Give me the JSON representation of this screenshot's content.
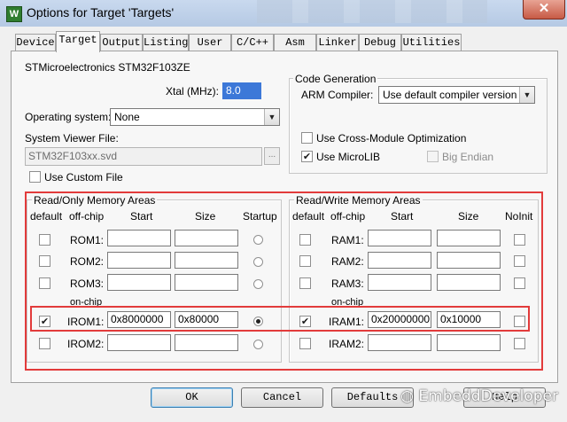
{
  "window": {
    "icon_glyph": "W",
    "title": "Options for Target 'Targets'",
    "close_glyph": "✕"
  },
  "tabs": [
    "Device",
    "Target",
    "Output",
    "Listing",
    "User",
    "C/C++",
    "Asm",
    "Linker",
    "Debug",
    "Utilities"
  ],
  "active_tab": "Target",
  "device_name": "STMicroelectronics STM32F103ZE",
  "xtal": {
    "label": "Xtal (MHz):",
    "value": "8.0"
  },
  "os": {
    "label": "Operating system:",
    "value": "None"
  },
  "svd": {
    "label": "System Viewer File:",
    "value": "STM32F103xx.svd",
    "browse": "...",
    "custom_label": "Use Custom File"
  },
  "codegen": {
    "title": "Code Generation",
    "compiler_label": "ARM Compiler:",
    "compiler_value": "Use default compiler version",
    "cross_module": "Use Cross-Module Optimization",
    "microlib": "Use MicroLIB",
    "big_endian": "Big Endian",
    "check_mark": "✔"
  },
  "rom": {
    "title": "Read/Only Memory Areas",
    "headers": {
      "default": "default",
      "offchip": "off-chip",
      "start": "Start",
      "size": "Size",
      "startup": "Startup"
    },
    "onchip": "on-chip",
    "rows": [
      {
        "label": "ROM1:",
        "start": "",
        "size": "",
        "default": false,
        "startup": false
      },
      {
        "label": "ROM2:",
        "start": "",
        "size": "",
        "default": false,
        "startup": false
      },
      {
        "label": "ROM3:",
        "start": "",
        "size": "",
        "default": false,
        "startup": false
      },
      {
        "label": "IROM1:",
        "start": "0x8000000",
        "size": "0x80000",
        "default": true,
        "startup": true
      },
      {
        "label": "IROM2:",
        "start": "",
        "size": "",
        "default": false,
        "startup": false
      }
    ]
  },
  "ram": {
    "title": "Read/Write Memory Areas",
    "headers": {
      "default": "default",
      "offchip": "off-chip",
      "start": "Start",
      "size": "Size",
      "noinit": "NoInit"
    },
    "onchip": "on-chip",
    "rows": [
      {
        "label": "RAM1:",
        "start": "",
        "size": ""
      },
      {
        "label": "RAM2:",
        "start": "",
        "size": ""
      },
      {
        "label": "RAM3:",
        "start": "",
        "size": ""
      },
      {
        "label": "IRAM1:",
        "start": "0x20000000",
        "size": "0x10000",
        "default": true
      },
      {
        "label": "IRAM2:",
        "start": "",
        "size": ""
      }
    ]
  },
  "buttons": {
    "ok": "OK",
    "cancel": "Cancel",
    "defaults": "Defaults",
    "help": "Help"
  },
  "watermark": "EmbeddDeveloper",
  "colors": {
    "highlight": "#e23b3b",
    "titlebar": "#c9d9ee"
  }
}
